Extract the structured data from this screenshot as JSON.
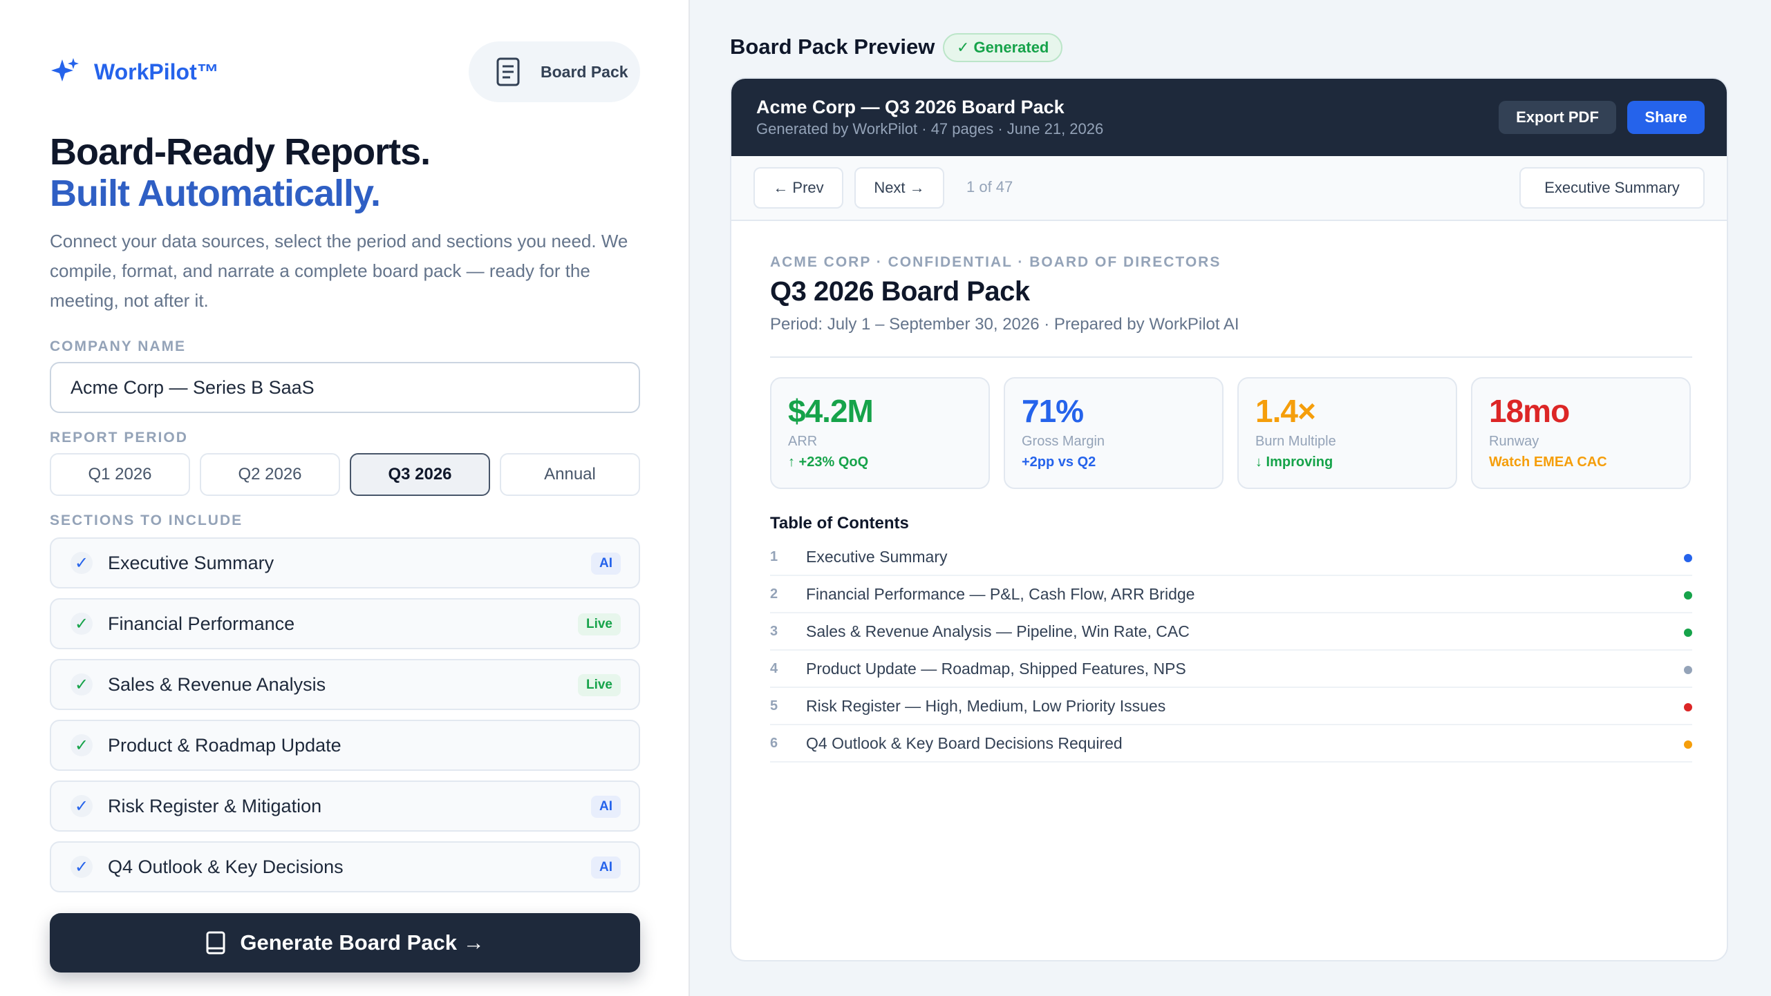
{
  "brand": {
    "name": "WorkPilot™"
  },
  "top_pill": {
    "label": "Board Pack",
    "icon": "document-icon"
  },
  "hero": {
    "line1": "Board-Ready Reports.",
    "line2": "Built Automatically.",
    "description": "Connect your data sources, select the period and sections you need. We compile, format, and narrate a complete board pack — ready for the meeting, not after it."
  },
  "form": {
    "company_label": "COMPANY NAME",
    "company_value": "Acme Corp — Series B SaaS",
    "period_label": "REPORT PERIOD",
    "periods": [
      {
        "label": "Q1 2026",
        "active": false
      },
      {
        "label": "Q2 2026",
        "active": false
      },
      {
        "label": "Q3 2026",
        "active": true
      },
      {
        "label": "Annual",
        "active": false
      }
    ],
    "sections_label": "SECTIONS TO INCLUDE",
    "sections": [
      {
        "name": "Executive Summary",
        "check_color": "#2563eb",
        "badge": "AI"
      },
      {
        "name": "Financial Performance",
        "check_color": "#16a34a",
        "badge": "Live"
      },
      {
        "name": "Sales & Revenue Analysis",
        "check_color": "#16a34a",
        "badge": "Live"
      },
      {
        "name": "Product & Roadmap Update",
        "check_color": "#16a34a",
        "badge": ""
      },
      {
        "name": "Risk Register & Mitigation",
        "check_color": "#2563eb",
        "badge": "AI"
      },
      {
        "name": "Q4 Outlook & Key Decisions",
        "check_color": "#2563eb",
        "badge": "AI"
      }
    ],
    "check_glyph": "✓",
    "generate_label": "Generate Board Pack →"
  },
  "preview": {
    "title": "Board Pack Preview",
    "status_chip": "✓ Generated",
    "doc_title": "Acme Corp — Q3 2026 Board Pack",
    "doc_subtitle": "Generated by WorkPilot · 47 pages · June 21, 2026",
    "export_label": "Export PDF",
    "share_label": "Share",
    "prev_label": "← Prev",
    "next_label": "Next →",
    "page_indicator": "1 of 47",
    "section_selector": "Executive Summary",
    "kicker": "ACME CORP · CONFIDENTIAL · BOARD OF DIRECTORS",
    "heading": "Q3 2026 Board Pack",
    "period_line": "Period: July 1 – September 30, 2026 · Prepared by WorkPilot AI",
    "kpis": [
      {
        "value": "$4.2M",
        "label": "ARR",
        "delta": "↑ +23% QoQ",
        "value_color": "#16a34a",
        "delta_color": "#16a34a"
      },
      {
        "value": "71%",
        "label": "Gross Margin",
        "delta": "+2pp vs Q2",
        "value_color": "#2563eb",
        "delta_color": "#2563eb"
      },
      {
        "value": "1.4×",
        "label": "Burn Multiple",
        "delta": "↓ Improving",
        "value_color": "#f59e0b",
        "delta_color": "#16a34a"
      },
      {
        "value": "18mo",
        "label": "Runway",
        "delta": "Watch EMEA CAC",
        "value_color": "#dc2626",
        "delta_color": "#f59e0b"
      }
    ],
    "toc_title": "Table of Contents",
    "toc": [
      {
        "num": "1",
        "text": "Executive Summary",
        "dot": "#2563eb"
      },
      {
        "num": "2",
        "text": "Financial Performance — P&L, Cash Flow, ARR Bridge",
        "dot": "#16a34a"
      },
      {
        "num": "3",
        "text": "Sales & Revenue Analysis — Pipeline, Win Rate, CAC",
        "dot": "#16a34a"
      },
      {
        "num": "4",
        "text": "Product Update — Roadmap, Shipped Features, NPS",
        "dot": "#94a3b8"
      },
      {
        "num": "5",
        "text": "Risk Register — High, Medium, Low Priority Issues",
        "dot": "#dc2626"
      },
      {
        "num": "6",
        "text": "Q4 Outlook & Key Board Decisions Required",
        "dot": "#f59e0b"
      }
    ]
  }
}
